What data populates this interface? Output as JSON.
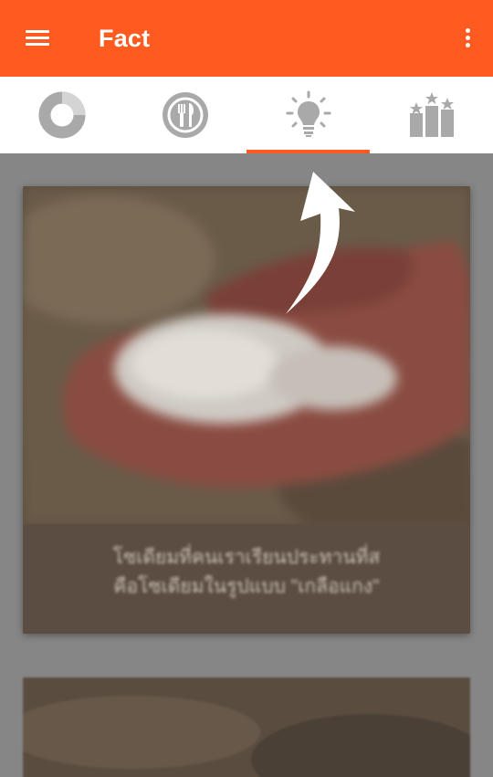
{
  "appbar": {
    "title": "Fact",
    "menu_icon": "hamburger-menu-icon",
    "more_icon": "more-vertical-icon",
    "background": "#ff5a1f"
  },
  "tabs": [
    {
      "id": "progress",
      "icon": "donut-chart-icon",
      "selected": false
    },
    {
      "id": "food",
      "icon": "plate-utensils-icon",
      "selected": false
    },
    {
      "id": "fact",
      "icon": "lightbulb-icon",
      "selected": true
    },
    {
      "id": "ranking",
      "icon": "leaderboard-podium-icon",
      "selected": false
    }
  ],
  "accent_color": "#ff5a1f",
  "feed": {
    "card1": {
      "image": "hand-holding-salt-photo",
      "caption_line1": "โซเดียมที่คนเราเรียนประทานที่ส",
      "caption_line2": "คือโซเดียมในรูปแบบ \"เกลือแกง\""
    },
    "card2": {
      "image": "soil-photo"
    }
  },
  "coach_mark": {
    "icon": "curved-arrow-pointer-icon",
    "target_tab": "fact"
  }
}
